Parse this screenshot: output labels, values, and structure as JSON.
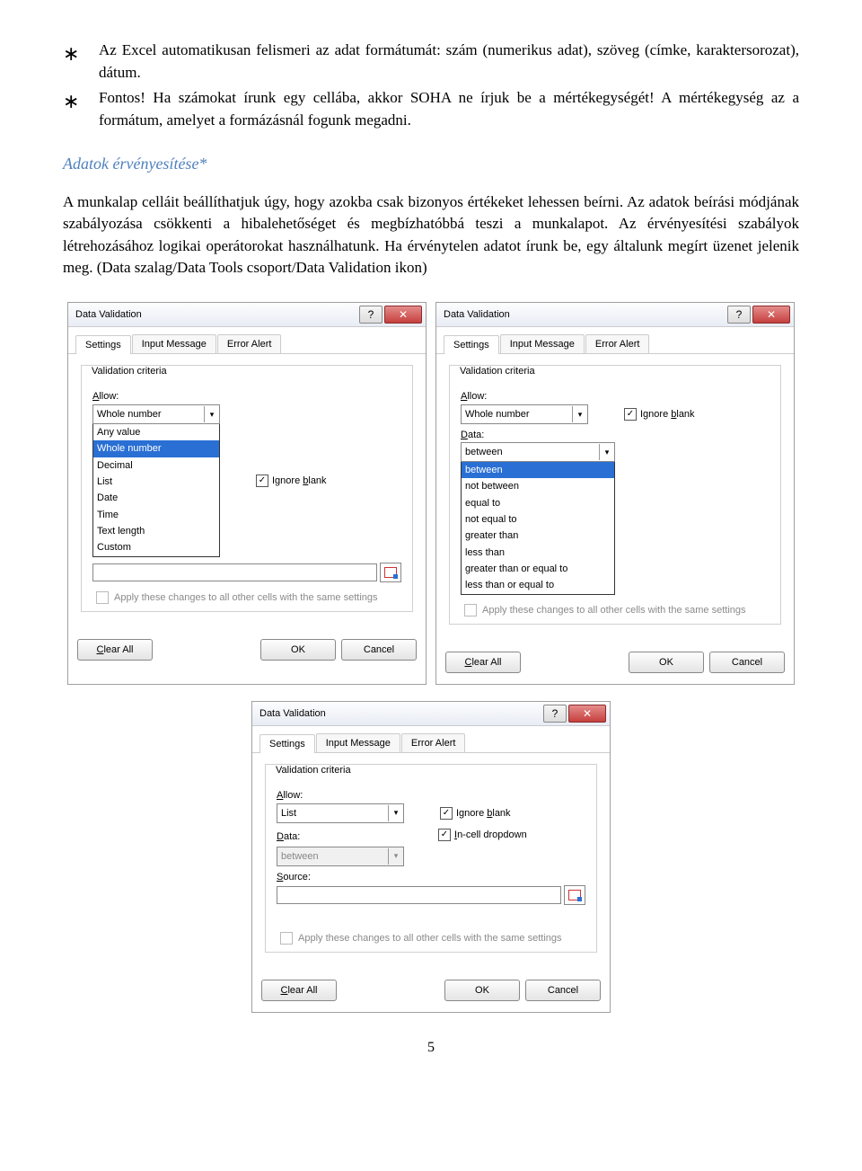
{
  "bullets": [
    "Az Excel automatikusan felismeri az adat formátumát: szám (numerikus adat), szöveg (címke, karaktersorozat), dátum.",
    "Fontos! Ha számokat írunk egy cellába, akkor SOHA ne írjuk be a mértékegységét! A mértékegység az a formátum, amelyet a formázásnál fogunk megadni."
  ],
  "heading": "Adatok érvényesítése*",
  "body": "A munkalap celláit beállíthatjuk úgy, hogy azokba csak bizonyos értékeket lehessen beírni. Az adatok beírási módjának szabályozása csökkenti a hibalehetőséget és megbízhatóbbá teszi a munkalapot. Az érvényesítési szabályok létrehozásához logikai operátorokat használhatunk. Ha érvénytelen adatot írunk be, egy általunk megírt üzenet jelenik meg.  (Data szalag/Data Tools csoport/Data Validation ikon)",
  "dlg": {
    "title": "Data Validation",
    "tabs": [
      "Settings",
      "Input Message",
      "Error Alert"
    ],
    "group": "Validation criteria",
    "allow": "Allow:",
    "data": "Data:",
    "source": "Source:",
    "ignore": "Ignore blank",
    "incell": "In-cell dropdown",
    "apply": "Apply these changes to all other cells with the same settings",
    "between": "between",
    "clear": "Clear All",
    "ok": "OK",
    "cancel": "Cancel",
    "help": "?",
    "close": "✕"
  },
  "allow_selected": "Whole number",
  "allow_options": [
    "Any value",
    "Whole number",
    "Decimal",
    "List",
    "Date",
    "Time",
    "Text length",
    "Custom"
  ],
  "data_selected": "between",
  "data_options": [
    "between",
    "not between",
    "equal to",
    "not equal to",
    "greater than",
    "less than",
    "greater than or equal to",
    "less than or equal to"
  ],
  "list_selected": "List",
  "page": "5"
}
